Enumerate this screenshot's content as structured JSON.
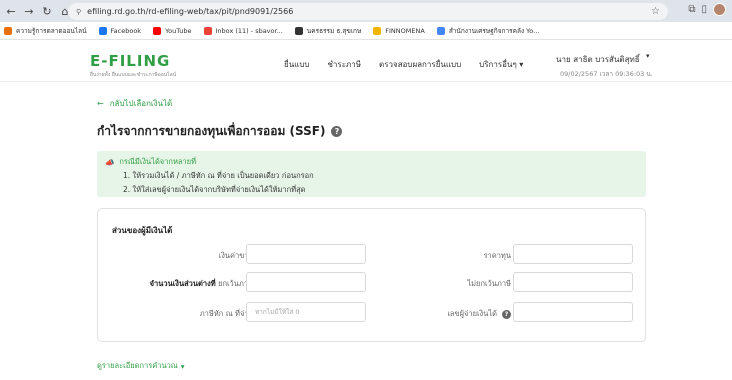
{
  "browser": {
    "url": "efiling.rd.go.th/rd-efiling-web/tax/pit/pnd9091/2566",
    "bookmarks": [
      {
        "label": "ความรู้การตลาดออนไลน์",
        "color": "#e8710a"
      },
      {
        "label": "Facebook",
        "color": "#1877f2"
      },
      {
        "label": "YouTube",
        "color": "#ff0000"
      },
      {
        "label": "Inbox (11) - sbavor...",
        "color": "#ea4335"
      },
      {
        "label": "นครธรรม ธ.สุขเกษ",
        "color": "#333333"
      },
      {
        "label": "FINNOMENA",
        "color": "#f4b400"
      },
      {
        "label": "สำนักงานเศรษฐกิจการคลัง Yo...",
        "color": "#4285f4"
      }
    ]
  },
  "header": {
    "logo": "E-FILING",
    "logo_sub": "ยื่นง่ายทั้ง ยื่นแบบและชำระภาษีออนไลน์",
    "menu": [
      "ยื่นแบบ",
      "ชำระภาษี",
      "ตรวจสอบผลการยื่นแบบ",
      "บริการอื่นๆ"
    ],
    "user_name": "นาย สาธิต บวรสันติสุทธิ์",
    "login_time": "09/02/2567 เวลา 09:36:03 น."
  },
  "main": {
    "back_label": "กลับไปเลือกเงินได้",
    "title": "กำไรจากการขายกองทุนเพื่อการออม (SSF)",
    "notice": {
      "heading": "กรณีมีเงินได้จากหลายที่",
      "lines": [
        "1. ให้รวมเงินได้ / ภาษีหัก ณ ที่จ่าย เป็นยอดเดียว ก่อนกรอก",
        "2. ให้ใส่เลขผู้จ่ายเงินได้จากบริษัทที่จ่ายเงินได้ให้มากที่สุด"
      ]
    },
    "form": {
      "section_title": "ส่วนของผู้มีเงินได้",
      "income_label": "เงินค่าขาย",
      "cost_label": "ราคาทุน",
      "diff_label_bold": "จำนวนเงินส่วนต่างที่",
      "diff_label_rest": "ยกเว้นภาษี",
      "non_exempt_label": "ไม่ยกเว้นภาษี",
      "withholding_label": "ภาษีหัก ณ ที่จ่าย",
      "withholding_placeholder": "หากไม่มีให้ใส่ 0",
      "payer_id_label": "เลขผู้จ่ายเงินได้"
    },
    "calc_link": "ดูรายละเอียดการคำนวณ"
  },
  "colors": {
    "accent": "#2f9e44",
    "notice_bg": "#e7f5e9"
  }
}
